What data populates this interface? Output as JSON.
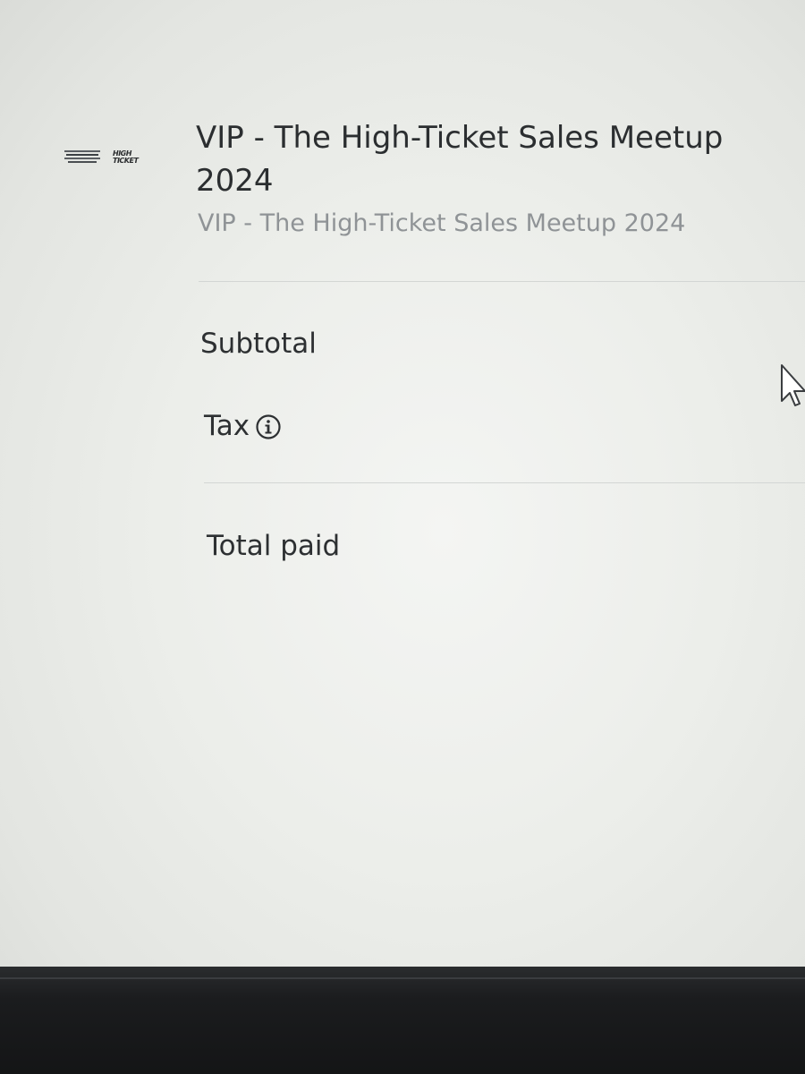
{
  "order_item": {
    "thumbnail_icon": "event-logo-icon",
    "thumbnail_text": "HIGH TICKET",
    "title": "VIP - The High-Ticket Sales Meetup 2024",
    "subtitle": "VIP - The High-Ticket Sales Meetup 2024"
  },
  "summary": {
    "subtotal_label": "Subtotal",
    "tax_label": "Tax",
    "tax_info_icon": "info-icon",
    "total_label": "Total paid"
  },
  "cursor": {
    "icon": "mouse-pointer-icon"
  }
}
